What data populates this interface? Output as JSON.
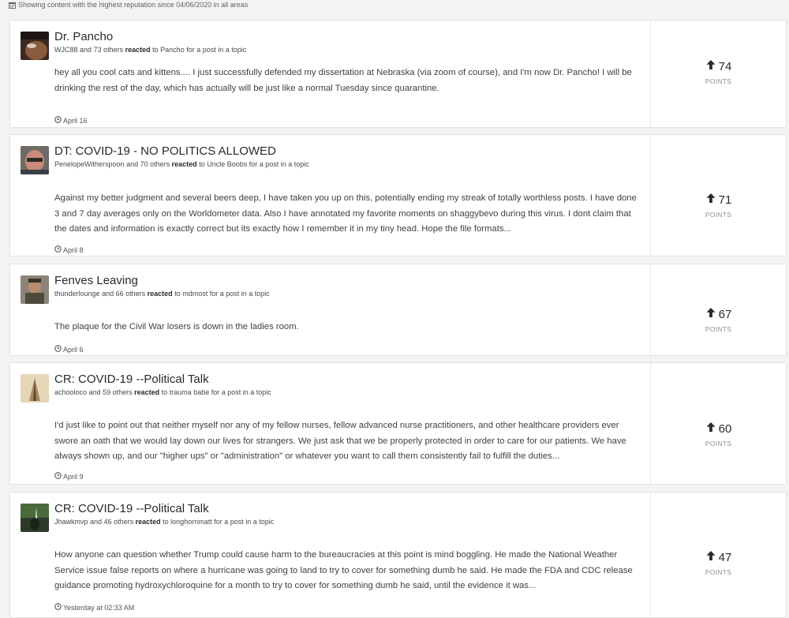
{
  "info": {
    "text": "Showing content with the highest reputation since 04/06/2020 in all areas"
  },
  "points_label": "POINTS",
  "posts": [
    {
      "title": "Dr. Pancho",
      "user": "WJC88",
      "others": "and 73 others",
      "reacted": "reacted",
      "to": "to",
      "target": "Pancho",
      "context": "for a post in a topic",
      "body": "hey all you cool cats and kittens.... I just successfully defended my dissertation at Nebraska (via zoom of course), and I'm now Dr. Pancho! I will be drinking the rest of the day, which has actually will be just like a normal Tuesday since quarantine.",
      "date": "April 16",
      "points": "74"
    },
    {
      "title": "DT: COVID-19 - NO POLITICS ALLOWED",
      "user": "PenelopeWitherspoon",
      "others": "and 70 others",
      "reacted": "reacted",
      "to": "to",
      "target": "Uncle Boobs",
      "context": "for a post in a topic",
      "body": "Against my better judgment and several beers deep, I have taken you up on this, potentially ending my streak of totally worthless posts. I have done 3 and 7 day averages only on the Worldometer data. Also I have annotated my favorite moments on shaggybevo during this virus. I dont claim that the dates and information is exactly correct but its exactly how I remember it in my tiny head. Hope the file formats...",
      "date": "April 8",
      "points": "71"
    },
    {
      "title": "Fenves Leaving",
      "user": "thunderlounge",
      "others": "and 66 others",
      "reacted": "reacted",
      "to": "to",
      "target": "mdmost",
      "context": "for a post in a topic",
      "body": "The plaque for the Civil War losers is down in the ladies room.",
      "date": "April 6",
      "points": "67"
    },
    {
      "title": "CR: COVID-19 --Political Talk",
      "user": "achooloco",
      "others": "and 59 others",
      "reacted": "reacted",
      "to": "to",
      "target": "trauma babe",
      "context": "for a post in a topic",
      "body": "I'd just like to point out that neither myself nor any of my fellow nurses, fellow advanced nurse practitioners, and other healthcare providers ever swore an oath that we would lay down our lives for strangers. We just ask that we be properly protected in order to care for our patients. We have always shown up, and our \"higher ups\" or \"administration\" or whatever you want to call them consistently fail to fulfill the duties...",
      "date": "April 9",
      "points": "60"
    },
    {
      "title": "CR: COVID-19 --Political Talk",
      "user": "Jhawkmvp",
      "others": "and 46 others",
      "reacted": "reacted",
      "to": "to",
      "target": "longhornmatt",
      "context": "for a post in a topic",
      "body": "How anyone can question whether Trump could cause harm to the bureaucracies at this point is mind boggling. He made the National Weather Service issue false reports on where a hurricane was going to land to try to cover for something dumb he said. He made the FDA and CDC release guidance promoting hydroxychloroquine for a month to try to cover for something dumb he said, until the evidence it was...",
      "date": "Yesterday at 02:33 AM",
      "points": "47"
    }
  ]
}
